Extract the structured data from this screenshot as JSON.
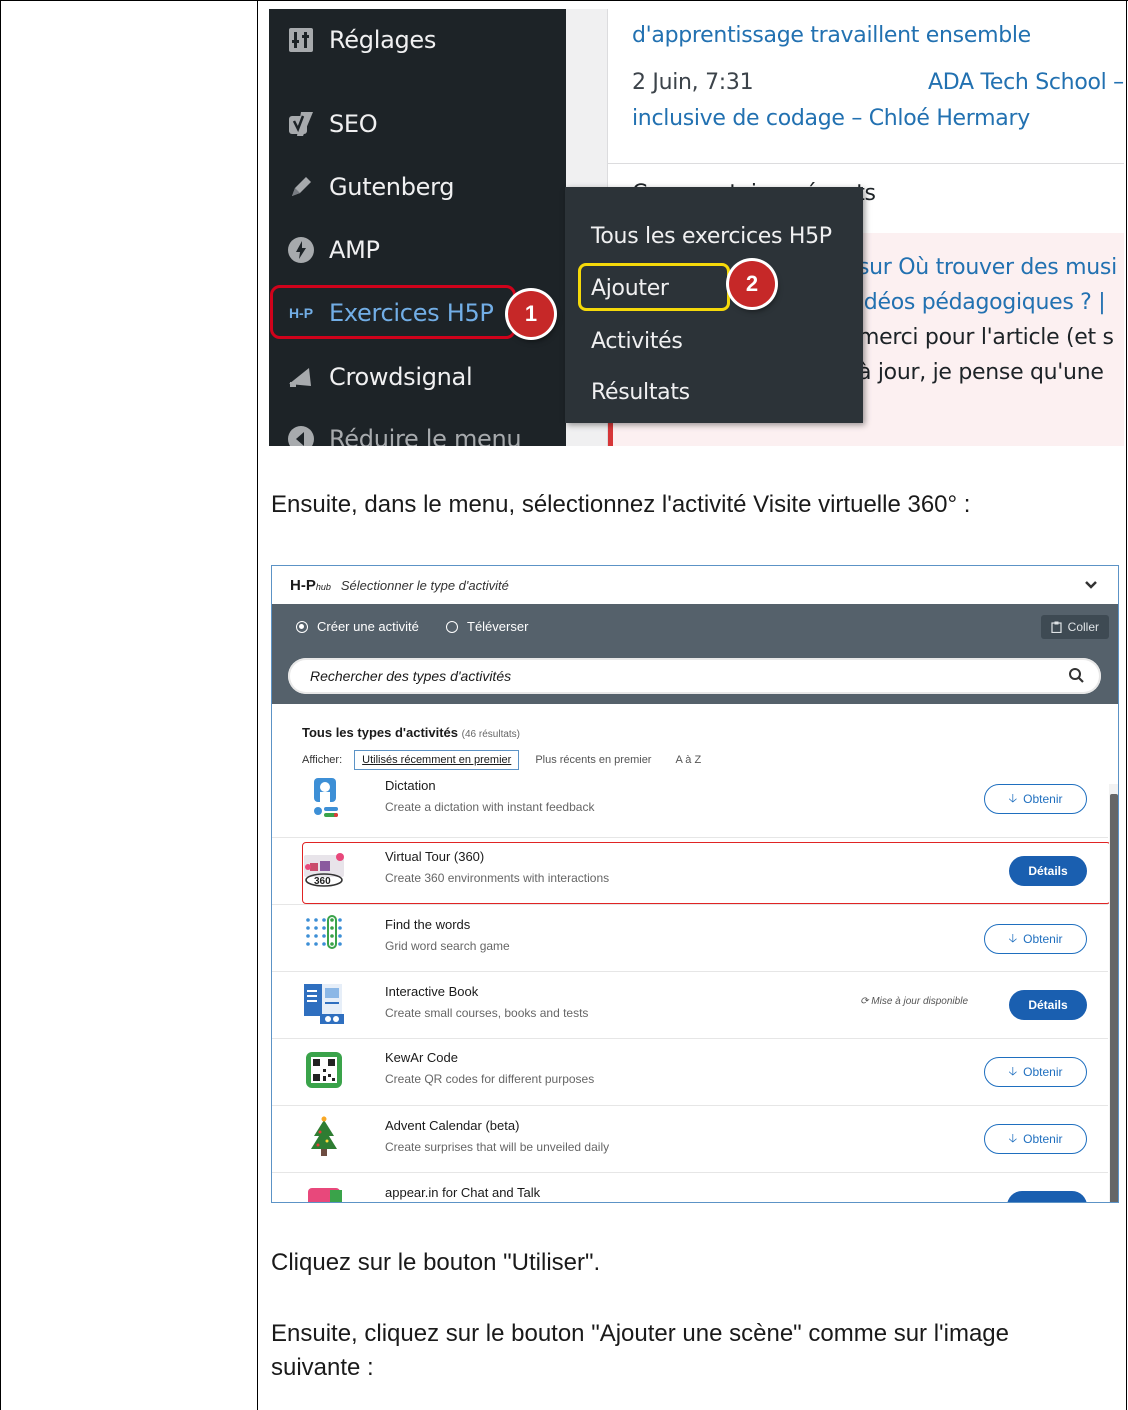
{
  "wp_screenshot": {
    "sidebar": [
      {
        "label": "Réglages",
        "icon": "settings-icon"
      },
      {
        "label": "SEO",
        "icon": "yoast-icon"
      },
      {
        "label": "Gutenberg",
        "icon": "pencil-icon"
      },
      {
        "label": "AMP",
        "icon": "lightning-icon"
      },
      {
        "label": "Exercices H5P",
        "icon": "h5p-icon",
        "prefix": "H-P"
      },
      {
        "label": "Crowdsignal",
        "icon": "megaphone-icon"
      },
      {
        "label": "Réduire le menu",
        "icon": "collapse-icon"
      }
    ],
    "submenu": [
      "Tous les exercices H5P",
      "Ajouter",
      "Activités",
      "Résultats"
    ],
    "badge1": "1",
    "badge2": "2",
    "content": {
      "line1": "d'apprentissage travaillent ensemble",
      "date": "2 Juin, 7:31",
      "link2": "ADA Tech School –",
      "line3": "inclusive de codage – Chloé Hermary",
      "heading": "Commentaires récents",
      "c1": "sur Où trouver des musi",
      "c2": "idéos pédagogiques ? |",
      "c3": "merci pour l'article (et s",
      "c4": "à jour, je pense qu'une"
    }
  },
  "prose": {
    "p1": "Ensuite, dans le menu, sélectionnez l'activité Visite virtuelle 360° :",
    "p2": "Cliquez sur le bouton \"Utiliser\".",
    "p3a": "Ensuite, cliquez sur le bouton \"Ajouter une scène\" comme sur l'image",
    "p3b": "suivante :"
  },
  "hub": {
    "logo": "H-P",
    "logo_sub": "hub",
    "title": "Sélectionner le type d'activité",
    "tab_create": "Créer une activité",
    "tab_upload": "Téléverser",
    "paste": "Coller",
    "search_placeholder": "Rechercher des types d'activités",
    "section": "Tous les types d'activités",
    "count": "(46 résultats)",
    "show": "Afficher:",
    "sort": [
      "Utilisés récemment en premier",
      "Plus récents en premier",
      "A à Z"
    ],
    "update_available": "Mise à jour disponible",
    "items": [
      {
        "title": "Dictation",
        "desc": "Create a dictation with instant feedback",
        "button": "Obtenir",
        "icon": "dictation-icon"
      },
      {
        "title": "Virtual Tour (360)",
        "desc": "Create 360 environments with interactions",
        "button": "Détails",
        "icon": "virtual-tour-360-icon"
      },
      {
        "title": "Find the words",
        "desc": "Grid word search game",
        "button": "Obtenir",
        "icon": "grid-dots-icon"
      },
      {
        "title": "Interactive Book",
        "desc": "Create small courses, books and tests",
        "button": "Détails",
        "icon": "interactive-book-icon"
      },
      {
        "title": "KewAr Code",
        "desc": "Create QR codes for different purposes",
        "button": "Obtenir",
        "icon": "qr-code-icon"
      },
      {
        "title": "Advent Calendar (beta)",
        "desc": "Create surprises that will be unveiled daily",
        "button": "Obtenir",
        "icon": "christmas-tree-icon"
      },
      {
        "title": "appear.in for Chat and Talk",
        "desc": "",
        "button": "",
        "icon": "chat-icon"
      }
    ]
  }
}
